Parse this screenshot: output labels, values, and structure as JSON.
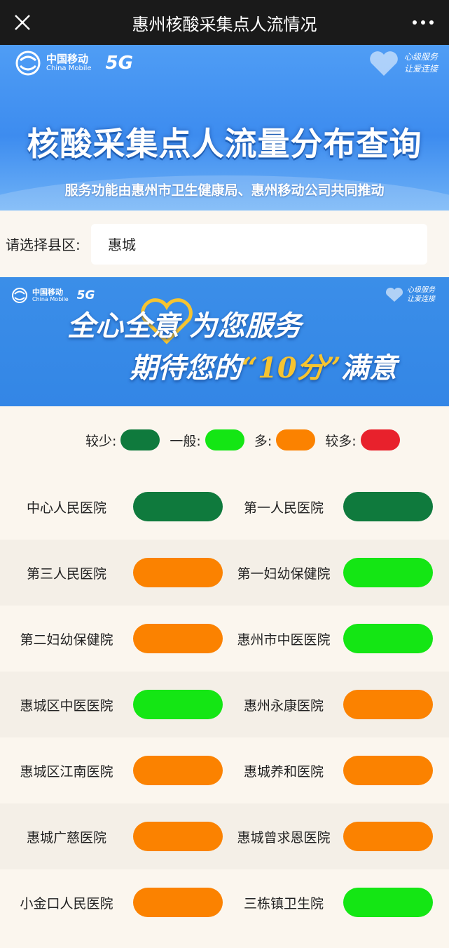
{
  "window": {
    "title": "惠州核酸采集点人流情况"
  },
  "hero": {
    "brand_cn": "中国移动",
    "brand_en": "China Mobile",
    "network": "5G",
    "tag_line1": "心级服务",
    "tag_line2": "让爱连接",
    "title": "核酸采集点人流量分布查询",
    "subtitle": "服务功能由惠州市卫生健康局、惠州移动公司共同推动"
  },
  "district": {
    "label": "请选择县区:",
    "value": "惠城"
  },
  "banner2": {
    "brand_cn": "中国移动",
    "brand_en": "China Mobile",
    "network": "5G",
    "tag_line1": "心级服务",
    "tag_line2": "让爱连接",
    "slogan_line1": "全心全意 为您服务",
    "slogan_line2_a": "期待您的",
    "slogan_line2_b": "“10分”",
    "slogan_line2_c": "满意"
  },
  "colors": {
    "low": "#0f7a3d",
    "normal": "#14e614",
    "busy": "#fb8200",
    "very_busy": "#e8212c"
  },
  "legend": [
    {
      "label": "较少:",
      "level": "low"
    },
    {
      "label": "一般:",
      "level": "normal"
    },
    {
      "label": "多:",
      "level": "busy"
    },
    {
      "label": "较多:",
      "level": "very_busy"
    }
  ],
  "hospitals": [
    [
      {
        "name": "中心人民医院",
        "level": "low"
      },
      {
        "name": "第一人民医院",
        "level": "low"
      }
    ],
    [
      {
        "name": "第三人民医院",
        "level": "busy"
      },
      {
        "name": "第一妇幼保健院",
        "level": "normal"
      }
    ],
    [
      {
        "name": "第二妇幼保健院",
        "level": "busy"
      },
      {
        "name": "惠州市中医医院",
        "level": "normal"
      }
    ],
    [
      {
        "name": "惠城区中医医院",
        "level": "normal"
      },
      {
        "name": "惠州永康医院",
        "level": "busy"
      }
    ],
    [
      {
        "name": "惠城区江南医院",
        "level": "busy"
      },
      {
        "name": "惠城养和医院",
        "level": "busy"
      }
    ],
    [
      {
        "name": "惠城广慈医院",
        "level": "busy"
      },
      {
        "name": "惠城曾求恩医院",
        "level": "busy"
      }
    ],
    [
      {
        "name": "小金口人民医院",
        "level": "busy"
      },
      {
        "name": "三栋镇卫生院",
        "level": "normal"
      }
    ]
  ]
}
